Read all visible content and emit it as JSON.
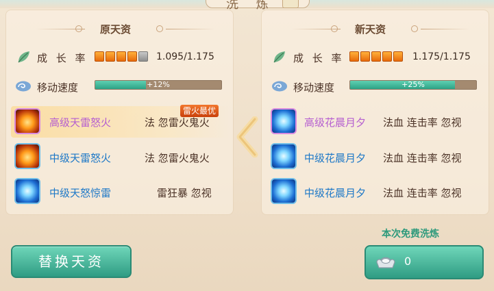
{
  "header": {
    "title": "洗 炼"
  },
  "left": {
    "title": "原天资",
    "growth": {
      "label": "成 长 率",
      "value": "1.095/1.175",
      "stars_filled": 4,
      "stars_total": 5
    },
    "speed": {
      "label": "移动速度",
      "value": "+12%",
      "fill": 0.12
    },
    "skills": [
      {
        "name": "高级天雷怒火",
        "tags": "法 忽雷火鬼火",
        "icon": "fire-lightning-icon",
        "rank": "high"
      },
      {
        "name": "中级天雷怒火",
        "tags": "法 忽雷火鬼火",
        "icon": "fire-lightning-icon",
        "rank": "mid"
      },
      {
        "name": "中级天怒惊雷",
        "tags": "雷狂暴 忽视",
        "icon": "thunder-orb-icon",
        "rank": "mid"
      }
    ],
    "best_badge": "雷火最优"
  },
  "right": {
    "title": "新天资",
    "growth": {
      "label": "成 长 率",
      "value": "1.175/1.175",
      "stars_filled": 5,
      "stars_total": 5
    },
    "speed": {
      "label": "移动速度",
      "value": "+25%",
      "fill": 0.25
    },
    "skills": [
      {
        "name": "高级花晨月夕",
        "tags": "法血 连击率 忽视",
        "icon": "blue-swirl-icon",
        "rank": "high"
      },
      {
        "name": "中级花晨月夕",
        "tags": "法血 连击率 忽视",
        "icon": "blue-swirl-icon",
        "rank": "mid"
      },
      {
        "name": "中级花晨月夕",
        "tags": "法血 连击率 忽视",
        "icon": "blue-swirl-icon",
        "rank": "mid"
      }
    ]
  },
  "actions": {
    "replace_label": "替换天资",
    "free_label": "本次免费洗炼",
    "wash_cost": "0"
  },
  "colors": {
    "accent": "#2f9c83",
    "star": "#f08a1c",
    "high_skill": "#b55ed0",
    "mid_skill": "#1d78c7"
  }
}
